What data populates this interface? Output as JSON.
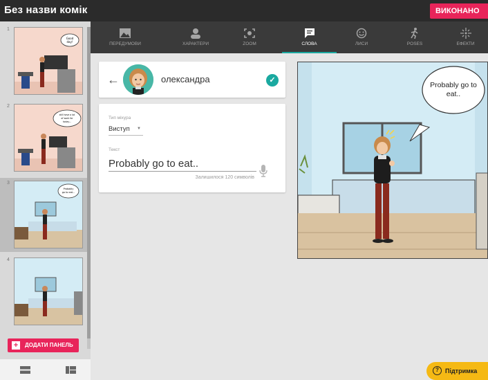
{
  "app": {
    "title": "Без назви комік",
    "done_label": "ВИКОНАНО"
  },
  "sidebar": {
    "panels": [
      {
        "number": "1",
        "bubble": "Good day!",
        "selected": false
      },
      {
        "number": "2",
        "bubble": "still have a lot of work for today...",
        "selected": false
      },
      {
        "number": "3",
        "bubble": "Probably go to eat...",
        "selected": true
      },
      {
        "number": "4",
        "bubble": "",
        "selected": false
      }
    ],
    "add_panel_label": "ДОДАТИ ПАНЕЛЬ"
  },
  "tabs": [
    {
      "label": "ПЕРЕДУМОВИ",
      "icon": "image-icon",
      "active": false
    },
    {
      "label": "ХАРАКТЕРИ",
      "icon": "person-icon",
      "active": false
    },
    {
      "label": "ZOOM",
      "icon": "zoom-icon",
      "active": false
    },
    {
      "label": "СЛОВА",
      "icon": "speech-bubble-icon",
      "active": true
    },
    {
      "label": "ЛИСИ",
      "icon": "smiley-icon",
      "active": false
    },
    {
      "label": "POSES",
      "icon": "running-person-icon",
      "active": false
    },
    {
      "label": "ЕФЕКТИ",
      "icon": "sparkle-icon",
      "active": false
    }
  ],
  "speaker": {
    "name": "олександра"
  },
  "bubble_options": {
    "type_label": "Тип міхура",
    "type_value": "Виступ",
    "text_label": "Текст",
    "text_value": "Probably go to eat..",
    "remaining": "Залишилося 120 символів"
  },
  "canvas": {
    "bubble_text": "Probably go to eat.."
  },
  "support_label": "Підтримка",
  "colors": {
    "accent": "#e8245a",
    "teal": "#1aa9a0",
    "toolbar": "#3a3a3a",
    "support": "#f5b914"
  }
}
